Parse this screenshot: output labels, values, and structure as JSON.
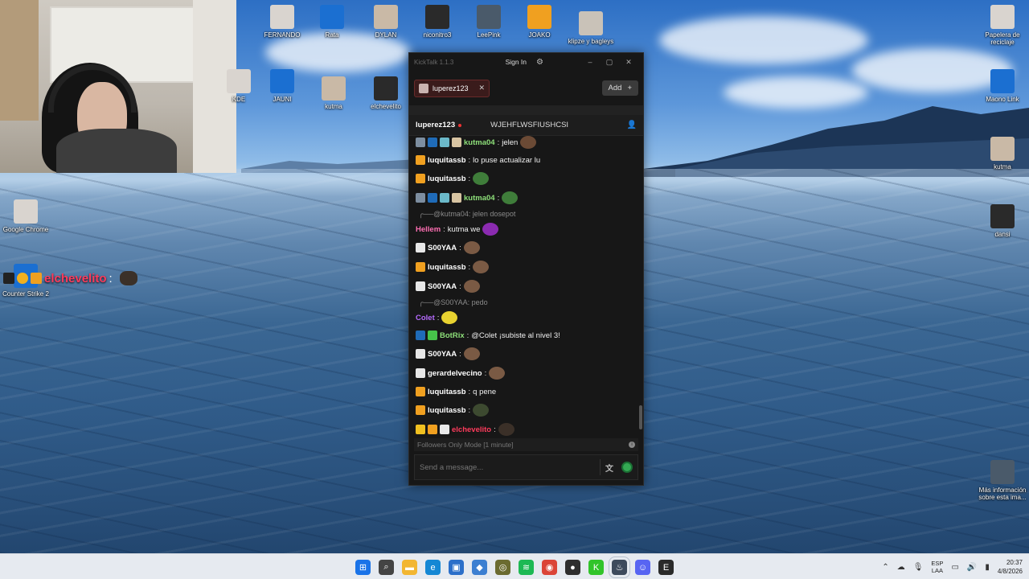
{
  "desktop": {
    "icons_top": [
      {
        "label": "FERNANDO",
        "icon": "cat-photo-icon"
      },
      {
        "label": "Rata",
        "icon": "rocket-league-icon"
      },
      {
        "label": "DYLAN",
        "icon": "photo-icon"
      },
      {
        "label": "niconitro3",
        "icon": "figure-icon"
      },
      {
        "label": "LeePink",
        "icon": "counter-strike-icon"
      },
      {
        "label": "JOAKO",
        "icon": "stumble-guys-icon"
      },
      {
        "label": "klipze y bagleys",
        "icon": "photo-icon"
      }
    ],
    "icons_row2": [
      {
        "label": "KDE",
        "icon": "app-icon"
      },
      {
        "label": "JAUNI",
        "icon": "dog-icon"
      },
      {
        "label": "kutma",
        "icon": "cat-icon"
      },
      {
        "label": "elchevelito",
        "icon": "cat-icon"
      }
    ],
    "icons_left": [
      {
        "label": "Google Chrome",
        "icon": "chrome-icon"
      },
      {
        "label": "Counter Strike 2",
        "icon": "counter-strike-icon"
      }
    ],
    "icons_right": [
      {
        "label": "Papelera de reciclaje",
        "icon": "recycle-bin-icon"
      },
      {
        "label": "Maono Link",
        "icon": "maono-icon"
      },
      {
        "label": "kutma",
        "icon": "file-icon"
      },
      {
        "label": "dansi",
        "icon": "photo-icon"
      },
      {
        "label": "Más información sobre esta ima...",
        "icon": "spotlight-icon"
      }
    ],
    "overlay_name": "elchevelito",
    "overlay_sep": ":"
  },
  "chat_window": {
    "app_title": "KickTalk 1.1.3",
    "sign_in": "Sign In",
    "tab_label": "luperez123",
    "add_label": "Add",
    "channel_user": "luperez123",
    "stream_title": "WJEHFLWSFIUSHCSI",
    "mode_text": "Followers Only Mode [1 minute]",
    "input_placeholder": "Send a message...",
    "accent": "#e64545"
  },
  "messages": [
    {
      "kind": "msg",
      "badges": [
        "#7d8ea0",
        "#1f6bb8",
        "#6bb9c9",
        "#d8c4a2"
      ],
      "user": "kutma04",
      "color": "#8ee07a",
      "text": "jelen",
      "emote": "#6b4a35"
    },
    {
      "kind": "msg",
      "badges": [
        "#f0a020"
      ],
      "user": "luquitassb",
      "color": "#ffffff",
      "text": "lo puse actualizar lu",
      "emote": ""
    },
    {
      "kind": "msg",
      "badges": [
        "#f0a020"
      ],
      "user": "luquitassb",
      "color": "#ffffff",
      "text": "",
      "emote": "#3f7d3a"
    },
    {
      "kind": "msg",
      "badges": [
        "#7d8ea0",
        "#1f6bb8",
        "#6bb9c9",
        "#d8c4a2"
      ],
      "user": "kutma04",
      "color": "#8ee07a",
      "text": "",
      "emote": "#3f7d3a"
    },
    {
      "kind": "reply",
      "text": "@kutma04: jelen dosepot"
    },
    {
      "kind": "msg",
      "badges": [],
      "user": "Hellem",
      "color": "#ff6fb3",
      "text": "kutma we",
      "emote": "#8b2bb0"
    },
    {
      "kind": "msg",
      "badges": [
        "#e8e8e8"
      ],
      "user": "S00YAA",
      "color": "#ffffff",
      "text": "",
      "emote": "#7a5a44"
    },
    {
      "kind": "msg",
      "badges": [
        "#f0a020"
      ],
      "user": "luquitassb",
      "color": "#ffffff",
      "text": "",
      "emote": "#7a5a44"
    },
    {
      "kind": "msg",
      "badges": [
        "#e8e8e8"
      ],
      "user": "S00YAA",
      "color": "#ffffff",
      "text": "",
      "emote": "#7a5a44"
    },
    {
      "kind": "reply",
      "text": "@S00YAA: pedo"
    },
    {
      "kind": "msg",
      "badges": [],
      "user": "Colet",
      "color": "#b66bff",
      "text": "",
      "emote": "#e8d230"
    },
    {
      "kind": "msg",
      "badges": [
        "#1f6bb8",
        "#46c24a"
      ],
      "user": "BotRix",
      "color": "#8ee07a",
      "text": "@Colet ¡subiste al nivel 3!",
      "emote": ""
    },
    {
      "kind": "msg",
      "badges": [
        "#e8e8e8"
      ],
      "user": "S00YAA",
      "color": "#ffffff",
      "text": "",
      "emote": "#7a5a44"
    },
    {
      "kind": "msg",
      "badges": [
        "#e8e8e8"
      ],
      "user": "gerardelvecino",
      "color": "#ffffff",
      "text": "",
      "emote": "#7a5a44"
    },
    {
      "kind": "msg",
      "badges": [
        "#f0a020"
      ],
      "user": "luquitassb",
      "color": "#ffffff",
      "text": "q pene",
      "emote": ""
    },
    {
      "kind": "msg",
      "badges": [
        "#f0a020"
      ],
      "user": "luquitassb",
      "color": "#ffffff",
      "text": "",
      "emote": "#3d4a30"
    },
    {
      "kind": "msg",
      "badges": [
        "#f0c020",
        "#f0a020",
        "#e8e8e8"
      ],
      "user": "elchevelito",
      "color": "#ff3b5c",
      "text": "",
      "emote": "#3b3028"
    }
  ],
  "taskbar": {
    "apps": [
      {
        "name": "start-button",
        "color": "#1a73e8",
        "glyph": "⊞"
      },
      {
        "name": "search-icon",
        "color": "#444444",
        "glyph": "⌕"
      },
      {
        "name": "file-explorer-icon",
        "color": "#f2b632",
        "glyph": "▬"
      },
      {
        "name": "edge-icon",
        "color": "#1487d4",
        "glyph": "e"
      },
      {
        "name": "store-icon",
        "color": "#2b6fc9",
        "glyph": "▣"
      },
      {
        "name": "app-icon",
        "color": "#3c7fd1",
        "glyph": "◆"
      },
      {
        "name": "gaming-icon",
        "color": "#6b6b30",
        "glyph": "◎"
      },
      {
        "name": "spotify-icon",
        "color": "#1db954",
        "glyph": "≋"
      },
      {
        "name": "chrome-icon",
        "color": "#db4437",
        "glyph": "◉"
      },
      {
        "name": "obs-icon",
        "color": "#2e2e2e",
        "glyph": "●"
      },
      {
        "name": "kick-icon",
        "color": "#31c42a",
        "glyph": "K"
      },
      {
        "name": "steam-icon",
        "color": "#1b2838",
        "glyph": "♨"
      },
      {
        "name": "discord-icon",
        "color": "#5865f2",
        "glyph": "☺"
      },
      {
        "name": "epic-icon",
        "color": "#2a2a2a",
        "glyph": "E"
      }
    ],
    "lang_top": "ESP",
    "lang_bottom": "LAA",
    "time": "20:37",
    "date": "4/8/2026"
  }
}
